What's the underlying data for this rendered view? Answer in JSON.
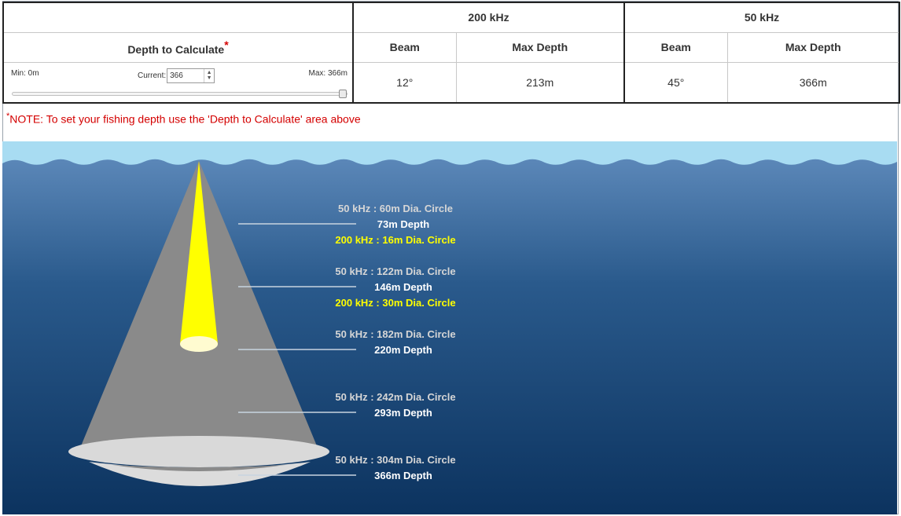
{
  "table": {
    "freq_200_label": "200 kHz",
    "freq_50_label": "50 kHz",
    "depth_to_calculate_label": "Depth to Calculate",
    "required_marker": "*",
    "beam_label": "Beam",
    "max_depth_label": "Max Depth",
    "slider": {
      "min_label": "Min: 0m",
      "max_label": "Max: 366m",
      "current_label": "Current:",
      "current_value": "366",
      "value_fraction": 1.0
    },
    "freq_200": {
      "beam": "12°",
      "max_depth": "213m"
    },
    "freq_50": {
      "beam": "45°",
      "max_depth": "366m"
    }
  },
  "note": {
    "marker": "*",
    "text": "NOTE: To set your fishing depth use the 'Depth to Calculate' area above"
  },
  "diagram": {
    "annotations": [
      {
        "circle_50": "50 kHz : 60m Dia. Circle",
        "depth": "73m Depth",
        "circle_200": "200 kHz : 16m Dia. Circle"
      },
      {
        "circle_50": "50 kHz : 122m Dia. Circle",
        "depth": "146m Depth",
        "circle_200": "200 kHz : 30m Dia. Circle"
      },
      {
        "circle_50": "50 kHz : 182m Dia. Circle",
        "depth": "220m Depth"
      },
      {
        "circle_50": "50 kHz : 242m Dia. Circle",
        "depth": "293m Depth"
      },
      {
        "circle_50": "50 kHz : 304m Dia. Circle",
        "depth": "366m Depth"
      }
    ],
    "colors": {
      "beam_50": "#8a8a8a",
      "beam_200": "#ffff00",
      "label_200": "#ffff00",
      "label_50": "#d6d6d6",
      "label_depth": "#ffffff",
      "water_top": "#5b87b8",
      "water_bottom": "#0c335f",
      "sky": "#a8dcf2"
    }
  }
}
